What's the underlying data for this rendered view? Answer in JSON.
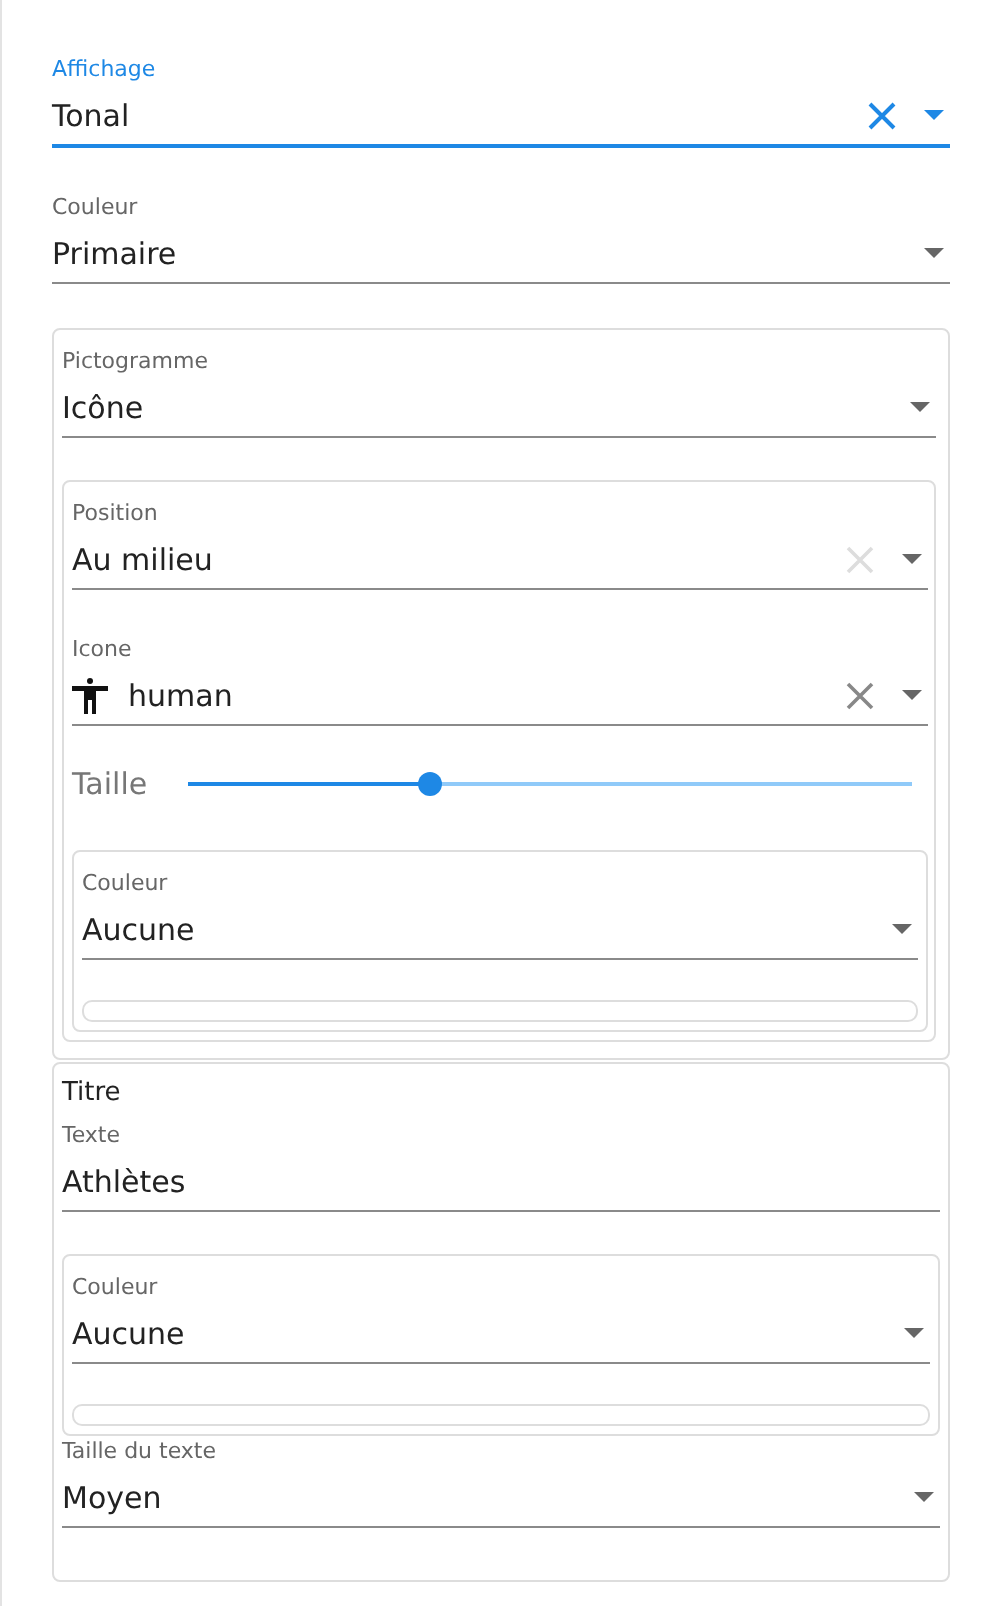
{
  "display": {
    "label": "Affichage",
    "value": "Tonal",
    "focused": true,
    "clearable": true,
    "clear_disabled": false
  },
  "color": {
    "label": "Couleur",
    "value": "Primaire",
    "focused": false,
    "clearable": false
  },
  "pictogram": {
    "type": {
      "label": "Pictogramme",
      "value": "Icône",
      "focused": false,
      "clearable": false
    },
    "position": {
      "label": "Position",
      "value": "Au milieu",
      "focused": false,
      "clearable": true,
      "clear_disabled": true
    },
    "icon": {
      "kind": "with-icon",
      "label": "Icone",
      "value": "human",
      "focused": false,
      "clearable": true,
      "clear_disabled": false
    },
    "size": {
      "label": "Taille",
      "level": 0.333
    },
    "color": {
      "label": "Couleur",
      "value": "Aucune",
      "focused": false,
      "clearable": false
    }
  },
  "title": {
    "heading": "Titre",
    "text": {
      "label": "Texte",
      "value": "Athlètes"
    },
    "color": {
      "label": "Couleur",
      "value": "Aucune",
      "focused": false,
      "clearable": false
    },
    "size": {
      "label": "Taille du texte",
      "value": "Moyen",
      "focused": false,
      "clearable": false
    }
  }
}
